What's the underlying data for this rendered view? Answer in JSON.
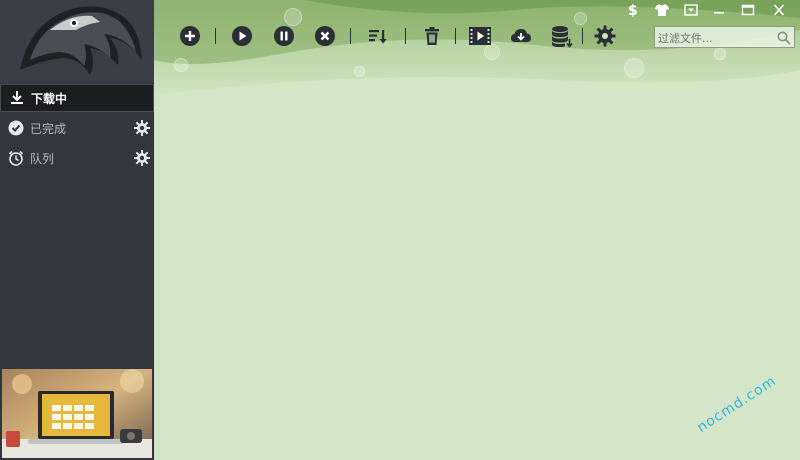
{
  "sidebar": {
    "items": [
      {
        "label": "下载中",
        "icon": "download-icon",
        "active": true
      },
      {
        "label": "已完成",
        "icon": "check-circle-icon",
        "active": false
      },
      {
        "label": "队列",
        "icon": "alarm-clock-icon",
        "active": false
      }
    ]
  },
  "toolbar": {
    "buttons": [
      "add-icon",
      "play-icon",
      "pause-icon",
      "stop-icon",
      "sort-icon",
      "trash-icon",
      "video-icon",
      "cloud-download-icon",
      "database-icon",
      "settings-icon"
    ]
  },
  "search": {
    "placeholder": "过滤文件..."
  },
  "window_controls": [
    "dollar-icon",
    "tshirt-icon",
    "dropdown-icon",
    "minimize-icon",
    "maximize-icon",
    "close-icon"
  ],
  "watermark": "nocmd.com",
  "colors": {
    "sidebar_bg": "#33363d",
    "main_bg": "#d3e5c6",
    "watermark": "#35b6e8"
  }
}
